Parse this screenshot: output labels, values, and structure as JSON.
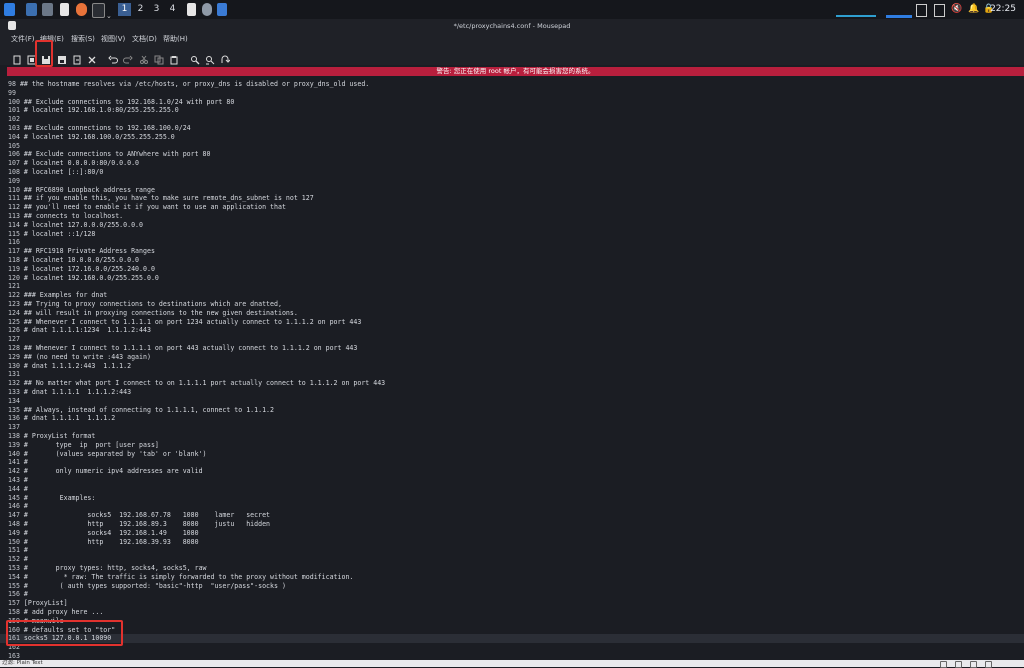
{
  "taskbar": {
    "workspaces": [
      "1",
      "2",
      "3",
      "4"
    ],
    "active_workspace": "1",
    "clock": "22:25"
  },
  "window": {
    "title": "*/etc/proxychains4.conf - Mousepad"
  },
  "menu": [
    "文件(F)",
    "编辑(E)",
    "搜索(S)",
    "视图(V)",
    "文档(D)",
    "帮助(H)"
  ],
  "toolbar": [
    "new-file-icon",
    "new-window-icon",
    "save-icon",
    "save-as-icon",
    "reload-icon",
    "close-icon",
    "undo-icon",
    "redo-icon",
    "cut-icon",
    "copy-icon",
    "paste-icon",
    "find-icon",
    "find-replace-icon",
    "goto-icon"
  ],
  "warning": "警告: 您正在使用 root 帐户，有可能会损害您的系统。",
  "editor": {
    "lines": [
      {
        "n": "98",
        "t": "## the hostname resolves via /etc/hosts, or proxy_dns is disabled or proxy_dns_old used."
      },
      {
        "n": "99",
        "t": ""
      },
      {
        "n": "100",
        "t": "## Exclude connections to 192.168.1.0/24 with port 80"
      },
      {
        "n": "101",
        "t": "# localnet 192.168.1.0:80/255.255.255.0"
      },
      {
        "n": "102",
        "t": ""
      },
      {
        "n": "103",
        "t": "## Exclude connections to 192.168.100.0/24"
      },
      {
        "n": "104",
        "t": "# localnet 192.168.100.0/255.255.255.0"
      },
      {
        "n": "105",
        "t": ""
      },
      {
        "n": "106",
        "t": "## Exclude connections to ANYwhere with port 80"
      },
      {
        "n": "107",
        "t": "# localnet 0.0.0.0:80/0.0.0.0"
      },
      {
        "n": "108",
        "t": "# localnet [::]:80/0"
      },
      {
        "n": "109",
        "t": ""
      },
      {
        "n": "110",
        "t": "## RFC6890 Loopback address range"
      },
      {
        "n": "111",
        "t": "## if you enable this, you have to make sure remote_dns_subnet is not 127"
      },
      {
        "n": "112",
        "t": "## you'll need to enable it if you want to use an application that"
      },
      {
        "n": "113",
        "t": "## connects to localhost."
      },
      {
        "n": "114",
        "t": "# localnet 127.0.0.0/255.0.0.0"
      },
      {
        "n": "115",
        "t": "# localnet ::1/128"
      },
      {
        "n": "116",
        "t": ""
      },
      {
        "n": "117",
        "t": "## RFC1918 Private Address Ranges"
      },
      {
        "n": "118",
        "t": "# localnet 10.0.0.0/255.0.0.0"
      },
      {
        "n": "119",
        "t": "# localnet 172.16.0.0/255.240.0.0"
      },
      {
        "n": "120",
        "t": "# localnet 192.168.0.0/255.255.0.0"
      },
      {
        "n": "121",
        "t": ""
      },
      {
        "n": "122",
        "t": "### Examples for dnat"
      },
      {
        "n": "123",
        "t": "## Trying to proxy connections to destinations which are dnatted,"
      },
      {
        "n": "124",
        "t": "## will result in proxying connections to the new given destinations."
      },
      {
        "n": "125",
        "t": "## Whenever I connect to 1.1.1.1 on port 1234 actually connect to 1.1.1.2 on port 443"
      },
      {
        "n": "126",
        "t": "# dnat 1.1.1.1:1234  1.1.1.2:443"
      },
      {
        "n": "127",
        "t": ""
      },
      {
        "n": "128",
        "t": "## Whenever I connect to 1.1.1.1 on port 443 actually connect to 1.1.1.2 on port 443"
      },
      {
        "n": "129",
        "t": "## (no need to write :443 again)"
      },
      {
        "n": "130",
        "t": "# dnat 1.1.1.2:443  1.1.1.2"
      },
      {
        "n": "131",
        "t": ""
      },
      {
        "n": "132",
        "t": "## No matter what port I connect to on 1.1.1.1 port actually connect to 1.1.1.2 on port 443"
      },
      {
        "n": "133",
        "t": "# dnat 1.1.1.1  1.1.1.2:443"
      },
      {
        "n": "134",
        "t": ""
      },
      {
        "n": "135",
        "t": "## Always, instead of connecting to 1.1.1.1, connect to 1.1.1.2"
      },
      {
        "n": "136",
        "t": "# dnat 1.1.1.1  1.1.1.2"
      },
      {
        "n": "137",
        "t": ""
      },
      {
        "n": "138",
        "t": "# ProxyList format"
      },
      {
        "n": "139",
        "t": "#       type  ip  port [user pass]"
      },
      {
        "n": "140",
        "t": "#       (values separated by 'tab' or 'blank')"
      },
      {
        "n": "141",
        "t": "#"
      },
      {
        "n": "142",
        "t": "#       only numeric ipv4 addresses are valid"
      },
      {
        "n": "143",
        "t": "#"
      },
      {
        "n": "144",
        "t": "#"
      },
      {
        "n": "145",
        "t": "#        Examples:"
      },
      {
        "n": "146",
        "t": "#"
      },
      {
        "n": "147",
        "t": "#               socks5  192.168.67.78   1080    lamer   secret"
      },
      {
        "n": "148",
        "t": "#               http    192.168.89.3    8080    justu   hidden"
      },
      {
        "n": "149",
        "t": "#               socks4  192.168.1.49    1080"
      },
      {
        "n": "150",
        "t": "#               http    192.168.39.93   8080"
      },
      {
        "n": "151",
        "t": "#"
      },
      {
        "n": "152",
        "t": "#"
      },
      {
        "n": "153",
        "t": "#       proxy types: http, socks4, socks5, raw"
      },
      {
        "n": "154",
        "t": "#         * raw: The traffic is simply forwarded to the proxy without modification."
      },
      {
        "n": "155",
        "t": "#        ( auth types supported: \"basic\"-http  \"user/pass\"-socks )"
      },
      {
        "n": "156",
        "t": "#"
      },
      {
        "n": "157",
        "t": "[ProxyList]"
      },
      {
        "n": "158",
        "t": "# add proxy here ..."
      },
      {
        "n": "159",
        "t": "# meanwile"
      },
      {
        "n": "160",
        "t": "# defaults set to \"tor\""
      },
      {
        "n": "161",
        "t": "socks5 127.0.0.1 10090"
      },
      {
        "n": "162",
        "t": ""
      },
      {
        "n": "163",
        "t": ""
      }
    ],
    "current_line": "161"
  },
  "status": {
    "text": "过滤: Plain Text"
  },
  "colors": {
    "warning_bg": "#b81f3d",
    "highlight": "#e2322e",
    "accent": "#3a5f93"
  }
}
